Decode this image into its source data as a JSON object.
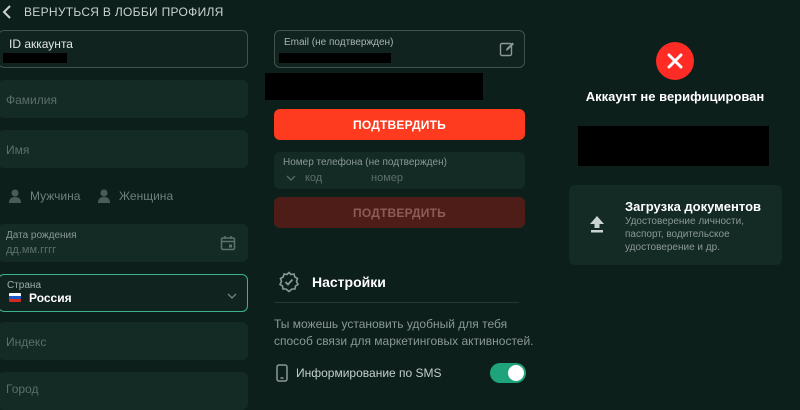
{
  "header": {
    "back_label": "ВЕРНУТЬСЯ В ЛОББИ ПРОФИЛЯ"
  },
  "left": {
    "account_id_label": "ID аккаунта",
    "surname_placeholder": "Фамилия",
    "name_placeholder": "Имя",
    "gender_male": "Мужчина",
    "gender_female": "Женщина",
    "birthdate_label": "Дата рождения",
    "birthdate_placeholder": "дд.мм.гггг",
    "country_label": "Страна",
    "country_value": "Россия",
    "index_placeholder": "Индекс",
    "city_placeholder": "Город"
  },
  "middle": {
    "email_label": "Email (не подтвержден)",
    "confirm_button": "ПОДТВЕРДИТЬ",
    "phone_label": "Номер телефона (не подтвержден)",
    "phone_code_placeholder": "код",
    "phone_number_placeholder": "номер",
    "confirm_phone_button": "ПОДТВЕРДИТЬ",
    "settings_title": "Настройки",
    "settings_desc": "Ты можешь установить удобный для тебя способ связи для маркетинговых активностей.",
    "sms_label": "Информирование по SMS",
    "sms_enabled": true
  },
  "right": {
    "status_title": "Аккаунт не верифицирован",
    "docs_title": "Загрузка документов",
    "docs_desc": "Удостоверение личности, паспорт, водительское удостоверение и др."
  },
  "colors": {
    "background": "#0d1f1b",
    "accent_red": "#ff3b1f",
    "toggle_green": "#1fa37a",
    "card": "#142a25"
  }
}
